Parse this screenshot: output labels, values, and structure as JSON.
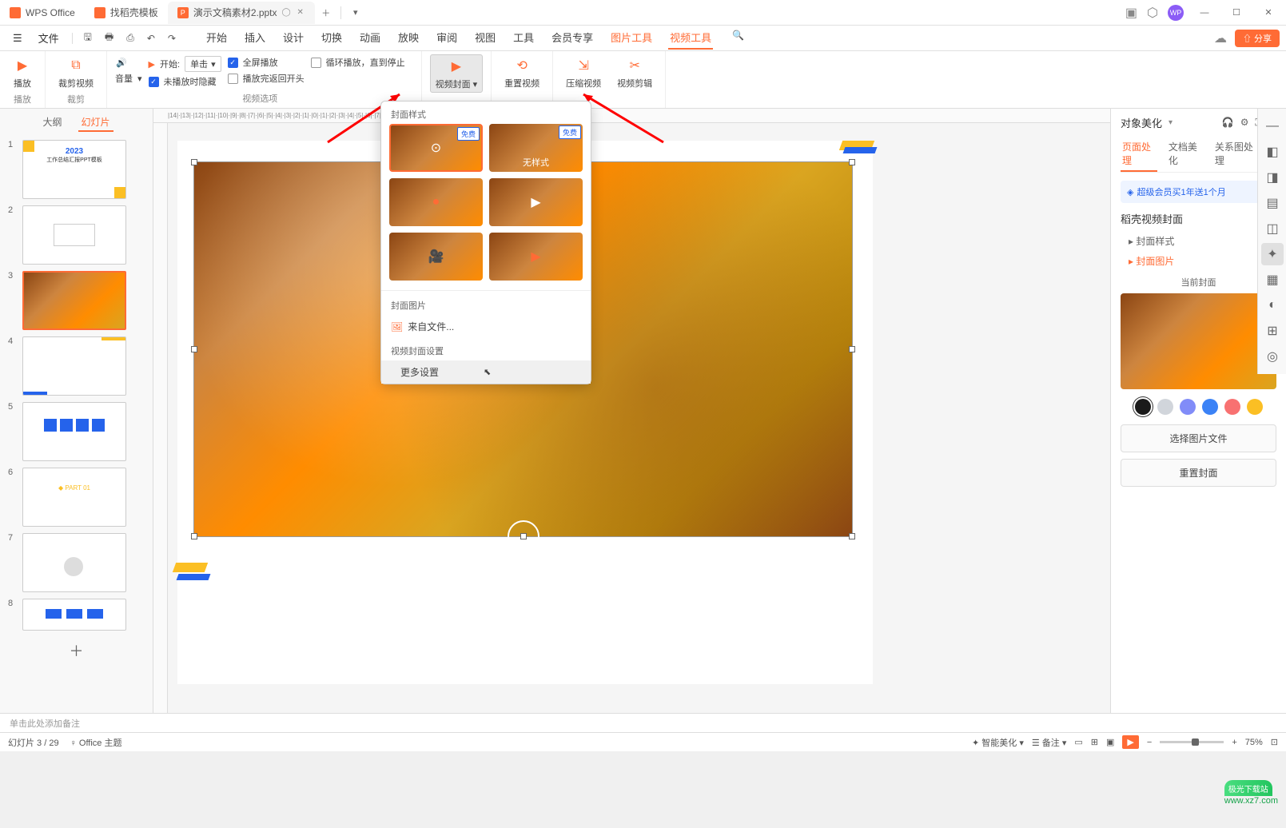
{
  "titlebar": {
    "app": "WPS Office",
    "tab2": "找稻壳模板",
    "tab3": "演示文稿素材2.pptx"
  },
  "menu": {
    "file": "文件",
    "tabs": [
      "开始",
      "插入",
      "设计",
      "切换",
      "动画",
      "放映",
      "审阅",
      "视图",
      "工具",
      "会员专享",
      "图片工具",
      "视频工具"
    ],
    "share": "分享"
  },
  "ribbon": {
    "play": "播放",
    "playGroup": "播放",
    "crop": "裁剪视频",
    "cropGroup": "裁剪",
    "volume": "音量",
    "start": "开始:",
    "startOption": "单击",
    "fullscreen": "全屏播放",
    "loop": "循环播放，直到停止",
    "hide": "未播放时隐藏",
    "rewind": "播放完返回开头",
    "optionsGroup": "视频选项",
    "cover": "视频封面",
    "resetVideo": "重置视频",
    "compress": "压缩视频",
    "videoEdit": "视频剪辑"
  },
  "slidePanel": {
    "outline": "大纲",
    "slides": "幻灯片",
    "thumb1_year": "2023",
    "thumb1_title": "工作总结汇报PPT模板",
    "nums": [
      "1",
      "2",
      "3",
      "4",
      "5",
      "6",
      "7",
      "8"
    ]
  },
  "popup": {
    "coverStyleLabel": "封面样式",
    "free": "免费",
    "noStyle": "无样式",
    "coverImage": "封面图片",
    "fromFile": "来自文件...",
    "coverSettings": "视频封面设置",
    "moreSettings": "更多设置"
  },
  "rightPanel": {
    "title": "对象美化",
    "tab1": "页面处理",
    "tab2": "文档美化",
    "tab3": "关系图处理",
    "banner": "超级会员买1年送1个月",
    "section": "稻壳视频封面",
    "sub1": "封面样式",
    "sub2": "封面图片",
    "previewLabel": "当前封面",
    "btn1": "选择图片文件",
    "btn2": "重置封面",
    "colors": [
      "#1a1a1a",
      "#d1d5db",
      "#818cf8",
      "#3b82f6",
      "#f87171",
      "#fbbf24"
    ]
  },
  "notes": "单击此处添加备注",
  "status": {
    "slideInfo": "幻灯片 3 / 29",
    "theme": "Office 主题",
    "beautify": "智能美化",
    "notes": "备注",
    "zoom": "75%"
  },
  "watermark": {
    "site": "极光下载站",
    "url": "www.xz7.com"
  }
}
